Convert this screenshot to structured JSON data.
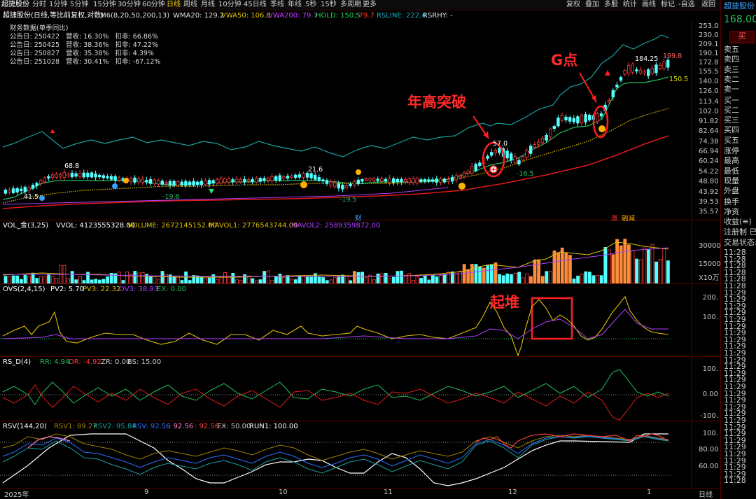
{
  "toolbar": {
    "stock_name": "超捷股份",
    "periods": [
      "分时",
      "1分钟",
      "5分钟",
      "15分钟",
      "30分钟",
      "60分钟",
      "日线",
      "周线",
      "月线",
      "10分钟",
      "45日线",
      "季线",
      "年线",
      "5秒",
      "15秒",
      "多周期",
      "更多"
    ],
    "active_period": "日线",
    "right_actions": [
      "复权",
      "叠加",
      "多股",
      "统计",
      "画线",
      "标记",
      "-自选",
      "返回"
    ]
  },
  "main_header": {
    "title": "超捷股份(日线,等比前复权,对数)",
    "ma": "M6(8,20,50,200,13)",
    "wma20": "WMA20: 129.2",
    "vwa50": "VWA50: 106.8",
    "vwa200": "VWA200: 79.7",
    "hold": "HOLD: 150.5",
    "hold_extra": ": 79.7",
    "rsline": "RSLINE: 222.4",
    "rsrhy": "RSRHY: -"
  },
  "financial": {
    "title": "财务数据(单季同比)",
    "rows": [
      "公告日: 250422   营收: 16.30%   扣非: 66.86%",
      "公告日: 250425   营收: 38.36%   扣非: 47.22%",
      "公告日: 250827   营收: 35.38%   扣非: 4.39%",
      "公告日: 251028   营收: 30.41%   扣非: -67.12%"
    ]
  },
  "price_axis": [
    "253.0",
    "230.0",
    "209.1",
    "190.1",
    "172.8",
    "155.5",
    "140.0",
    "126.0",
    "113.4",
    "102.0",
    "91.82",
    "82.64",
    "74.38",
    "66.94",
    "60.24",
    "54.22",
    "48.80",
    "43.92",
    "39.53",
    "35.57"
  ],
  "price_labels": {
    "low": "41.5",
    "high1": "68.8",
    "l1": "-19.6",
    "m1": "21.6",
    "l2": "-19.5",
    "p57": "57.0",
    "l3": "-16.5",
    "p184": "184.25",
    "p199": "199.8",
    "hold_val": "150.5",
    "cai": "财",
    "zhang": "涨",
    "rongjian": "融减"
  },
  "annotations": {
    "year_high": "年高突破",
    "g_point": "G点",
    "qidui": "起堆"
  },
  "vol_panel": {
    "title": "VOL_金(3,25)",
    "vvol": "VVOL: 4123555328.00",
    "volume": "VOLUME: 2672145152.00",
    "mavol1": "MAVOL1: 2776543744.00",
    "mavol2": "MAVOL2: 2589359872.00",
    "axis": [
      "30000",
      "15000"
    ],
    "unit": "X10万"
  },
  "ovs_panel": {
    "title": "OVS(2,4,15)",
    "pv2": "PV2: 5.70",
    "pv3": "PV3: 22.32",
    "ov3": "OV3: 38.93",
    "ex": "EX: 0.00",
    "axis": [
      "200.",
      "100."
    ]
  },
  "rsd_panel": {
    "title": "RS_D(4)",
    "rr": "RR: 4.94",
    "dr": "DR: -4.92",
    "zr": "ZR: 0.00",
    "bs": "BS: 15.00",
    "axis": [
      "100.",
      "0.00",
      "-100."
    ]
  },
  "rsv_panel": {
    "title": "RSV(144,20)",
    "rsv1": "RSV1: 89.27",
    "rsv2": "RSV2: 95.84",
    "rsv": "RSV: 92.56",
    "v1": ": 92.56",
    "v2": ": 92.56",
    "ex": "EX: 50.00",
    "run1": "RUN1: 100.00",
    "axis": [
      "100.",
      "80.00",
      "60.00"
    ]
  },
  "x_axis": {
    "labels": [
      "2025年",
      "9",
      "10",
      "11",
      "12",
      "1"
    ],
    "period": "日线"
  },
  "sidebar": {
    "name": "超捷股份",
    "price": "168.00",
    "buy_button": "买",
    "sell_levels": [
      "卖五",
      "卖四",
      "卖三",
      "卖二",
      "卖一"
    ],
    "buy_levels": [
      "买一",
      "买二",
      "买三",
      "买四",
      "买五"
    ],
    "stats": [
      "涨停",
      "最高",
      "最低",
      "现量",
      "外盘"
    ],
    "stats2": [
      "换手",
      "净资",
      "收益(≡)"
    ],
    "reg": "注册制 已",
    "trade_status": "交易状态:",
    "ticks": [
      "11:28",
      "11:28",
      "11:28",
      "11:28",
      "11:28",
      "11:28",
      "11:29",
      "11:29",
      "11:29",
      "11:29",
      "11:29",
      "11:29",
      "11:29",
      "11:29",
      "11:29",
      "11:29",
      "11:29",
      "11:29",
      "11:29",
      "11:29",
      "11:29",
      "11:29",
      "11:29",
      "11:29",
      "11:29",
      "11:29",
      "11:29",
      "11:29",
      "11:29",
      "11:29",
      "11:29",
      "11:29",
      "11:29",
      "11:29"
    ],
    "bottom": "11:28"
  },
  "colors": {
    "up": "#ff3b3b",
    "down": "#54ffff",
    "vol_orange": "#ff8c3a",
    "ma_green": "#22c05a",
    "ma_yellow": "#e0c000",
    "ma_red": "#e01a1a",
    "teal": "#1aa0a0"
  }
}
